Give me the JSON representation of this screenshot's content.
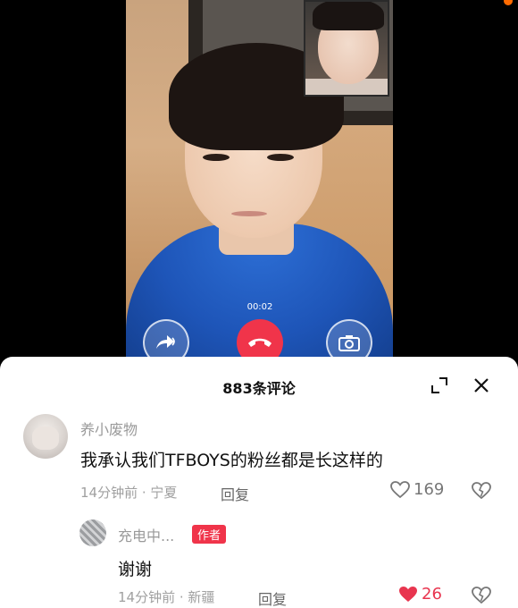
{
  "call": {
    "timer": "00:02",
    "buttons": [
      {
        "name": "share-button",
        "icon": "share-arrow-icon"
      },
      {
        "name": "hangup-button",
        "icon": "phone-hangup-icon"
      },
      {
        "name": "camera-switch-button",
        "icon": "camera-icon"
      }
    ]
  },
  "sheet": {
    "title": "883条评论",
    "icons": {
      "expand": "expand-icon",
      "close": "close-icon"
    }
  },
  "comments": [
    {
      "username": "养小废物",
      "text": "我承认我们TFBOYS的粉丝都是长这样的",
      "time": "14分钟前",
      "location": "宁夏",
      "reply_label": "回复",
      "likes": "169",
      "liked": false
    },
    {
      "username": "充电中...",
      "badge": "作者",
      "text": "谢谢",
      "time": "14分钟前",
      "location": "新疆",
      "reply_label": "回复",
      "likes": "26",
      "liked": true
    }
  ],
  "colors": {
    "accent_red": "#f0344a",
    "like_active": "#e8354f",
    "hoodie_blue": "#1e55b8"
  }
}
